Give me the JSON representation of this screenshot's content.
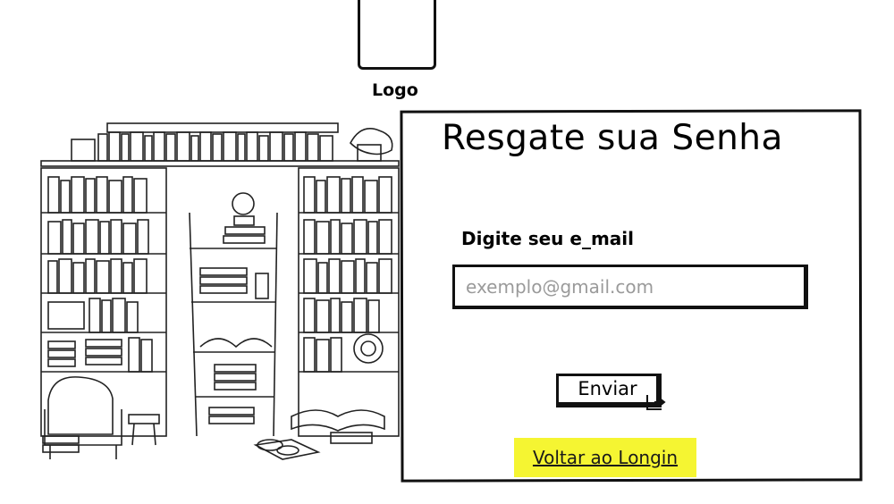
{
  "logo": {
    "label": "Logo"
  },
  "panel": {
    "title": "Resgate sua Senha",
    "email_label": "Digite seu e_mail",
    "email_placeholder": "exemplo@gmail.com",
    "email_value": "",
    "send_label": "Enviar",
    "back_link": "Voltar ao Longin"
  },
  "colors": {
    "highlight": "#f5f532",
    "ink": "#111111",
    "placeholder": "#9a9a9a"
  },
  "icons": {
    "illustration": "bookshelf-illustration",
    "cursor": "cursor-icon"
  }
}
